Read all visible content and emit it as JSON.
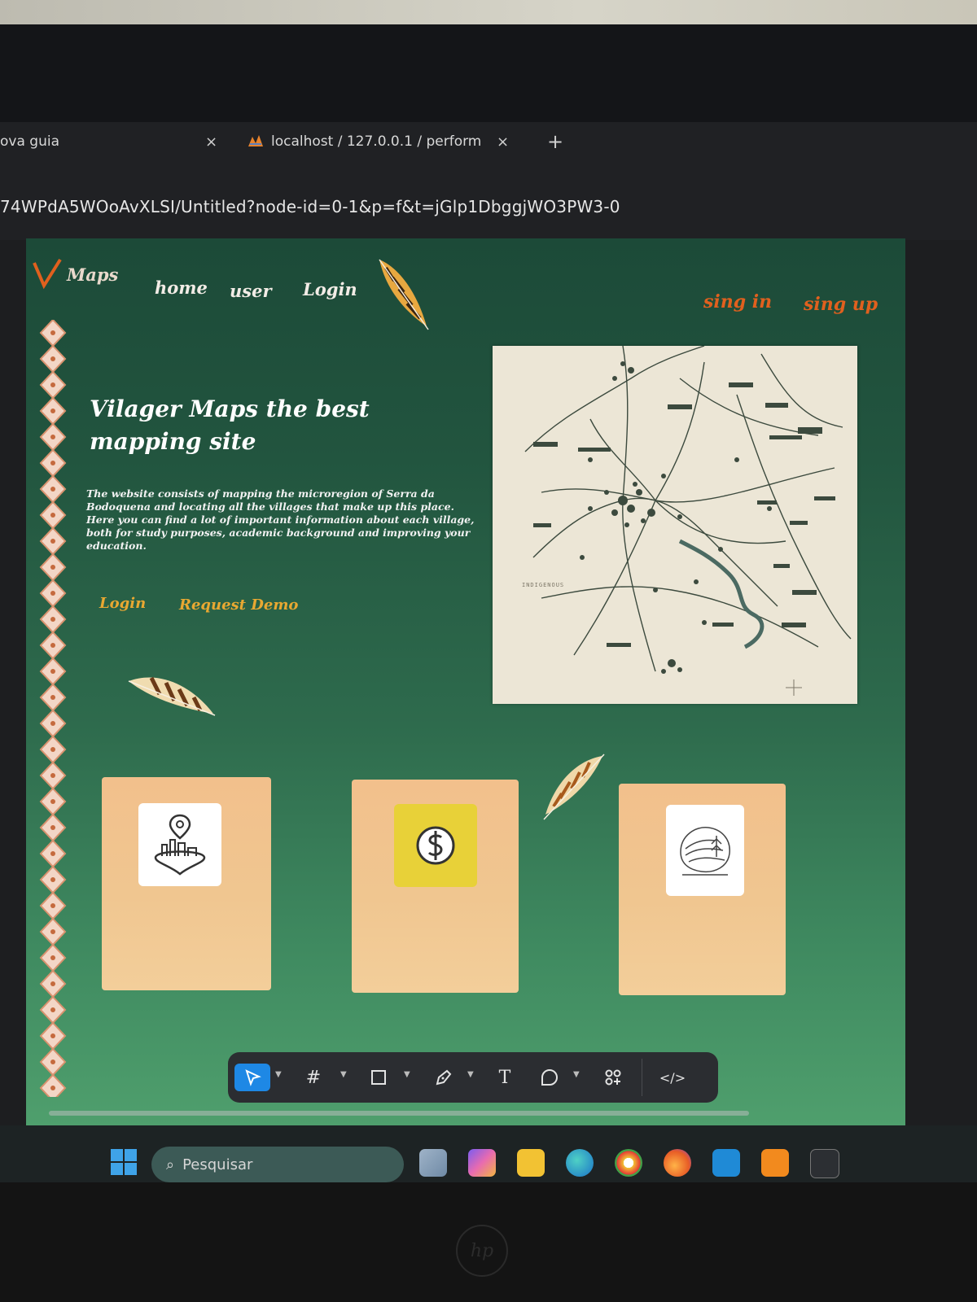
{
  "browser": {
    "tab1_title": "ova guia",
    "tab2_title": "localhost / 127.0.0.1 / perform",
    "close_glyph": "×",
    "new_tab_glyph": "+",
    "url": "74WPdA5WOoAvXLSI/Untitled?node-id=0-1&p=f&t=jGlp1DbggjWO3PW3-0"
  },
  "site": {
    "logo_text": "Maps",
    "nav": {
      "home": "home",
      "user": "user",
      "login": "Login"
    },
    "auth": {
      "sign_in": "sing in",
      "sign_up": "sing up"
    },
    "hero_title": "Vilager Maps the best mapping site",
    "hero_description": "The website consists of mapping the microregion of Serra da Bodoquena and locating all the villages that make up this place. Here you can find a lot of important information about each village, both for study purposes, academic background and improving your education.",
    "cta_login": "Login",
    "cta_demo": "Request Demo",
    "map_label": "INDIGENOUS",
    "cards": [
      {
        "icon": "village-location-icon"
      },
      {
        "icon": "dollar-icon"
      },
      {
        "icon": "landscape-icon"
      }
    ]
  },
  "editor_toolbar": {
    "tools": [
      "move-tool",
      "frame-tool",
      "shape-tool",
      "pen-tool",
      "text-tool",
      "comment-tool",
      "actions-tool",
      "dev-mode-tool"
    ],
    "text_tool_glyph": "T",
    "frame_tool_glyph": "#",
    "dev_mode_glyph": "</>"
  },
  "taskbar": {
    "search_placeholder": "Pesquisar"
  },
  "colors": {
    "canvas_top": "#1c4a38",
    "canvas_bottom": "#4f9f6d",
    "accent_orange": "#e0601e",
    "cta_gold": "#e8a832",
    "card_peach": "#f2c08c"
  }
}
